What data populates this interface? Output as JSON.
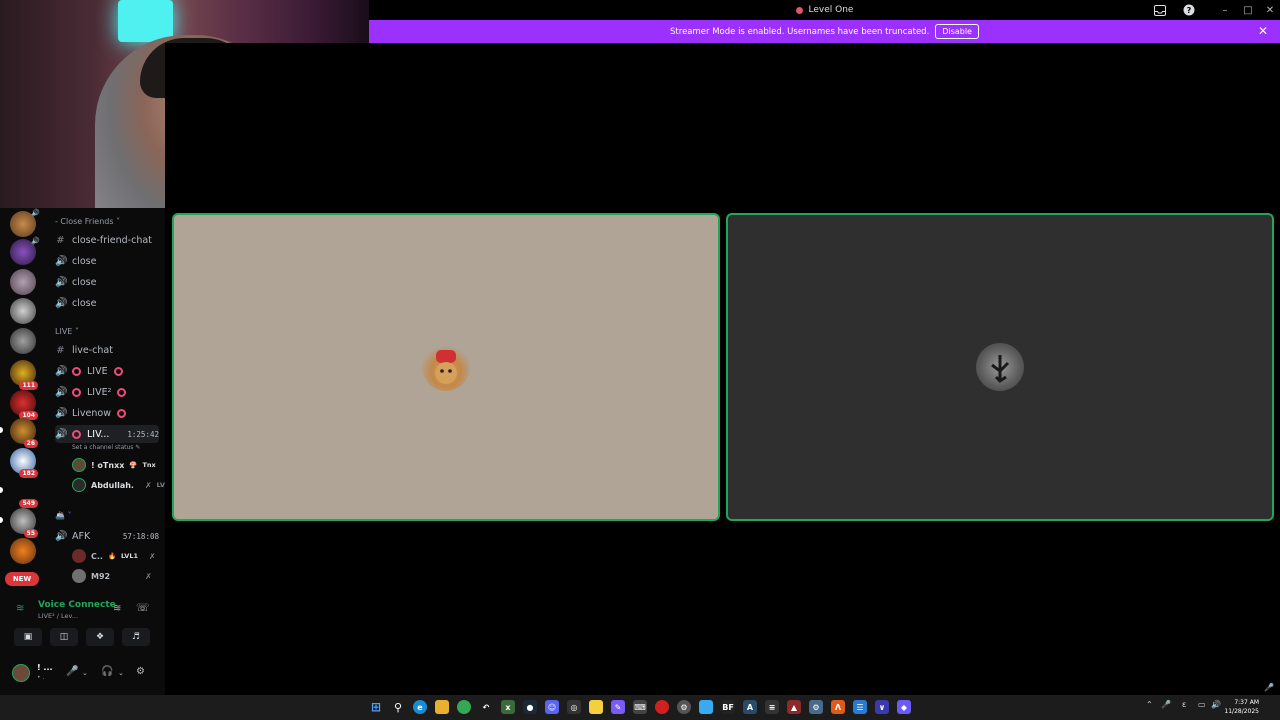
{
  "window": {
    "title": "Level One"
  },
  "banner": {
    "message": "Streamer Mode is enabled. Usernames have been truncated.",
    "disable_label": "Disable"
  },
  "servers": {
    "badges": [
      "111",
      "104",
      "26",
      "182",
      "549",
      "55"
    ],
    "new_label": "NEW"
  },
  "channels": {
    "cat1": "- Close Friends ˅",
    "c1": "close-friend-chat",
    "c2": "close",
    "c3": "close",
    "c4": "close",
    "cat2": "LIVE ˅",
    "c5": "live-chat",
    "c6": "LIVE",
    "c7": "LIVE²",
    "c8": "Livenow",
    "c9": "LIV...",
    "c9_timer": "1:25:42",
    "c9_status": "Set a channel status ✎",
    "m1_name": "! oTnxx",
    "m1_tag": "Tnx",
    "m2_name": "Abdullah.",
    "m2_tag": "LV",
    "cat3": "˅",
    "c10": "AFK",
    "c10_timer": "57:18:08",
    "m3_name": "C..",
    "m3_tag": "LVL1",
    "m4_name": "M92"
  },
  "voice": {
    "title": "Voice Connecte",
    "sub": "LIVE² / Lev..."
  },
  "user": {
    "name": "! ...",
    "status": "• ."
  },
  "colors": {
    "banner": "#9b30ff",
    "speaking": "#23a55a",
    "live": "#f04b7a",
    "badge": "#da373c"
  },
  "taskbar": {
    "time": "7:37 AM",
    "date": "11/28/2025",
    "lang": "ε"
  }
}
